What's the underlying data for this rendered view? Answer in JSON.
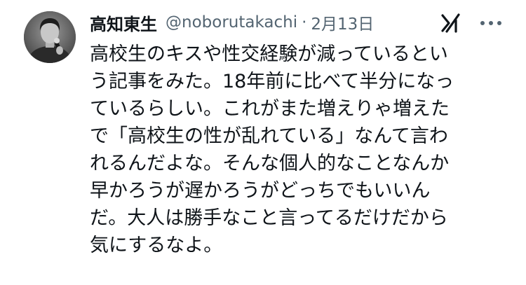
{
  "tweet": {
    "author_name": "高知東生",
    "handle": "@noborutakachi",
    "separator": "·",
    "date": "2月13日",
    "lines": [
      "高校生のキスや性交経験が減っているとい",
      "う記事をみた。18年前に比べて半分になっ",
      "ているらしい。これがまた増えりゃ増えた",
      "で「高校生の性が乱れている」なんて言わ",
      "れるんだよな。そんな個人的なことなんか",
      "早かろうが遅かろうがどっちでもいいん",
      "だ。大人は勝手なこと言ってるだけだから",
      "気にするなよ。"
    ]
  },
  "icons": {
    "avatar": "profile-photo",
    "grok": "grok-icon",
    "more": "more-options-icon"
  },
  "colors": {
    "text": "#0f1419",
    "secondary": "#536471",
    "background": "#ffffff"
  }
}
